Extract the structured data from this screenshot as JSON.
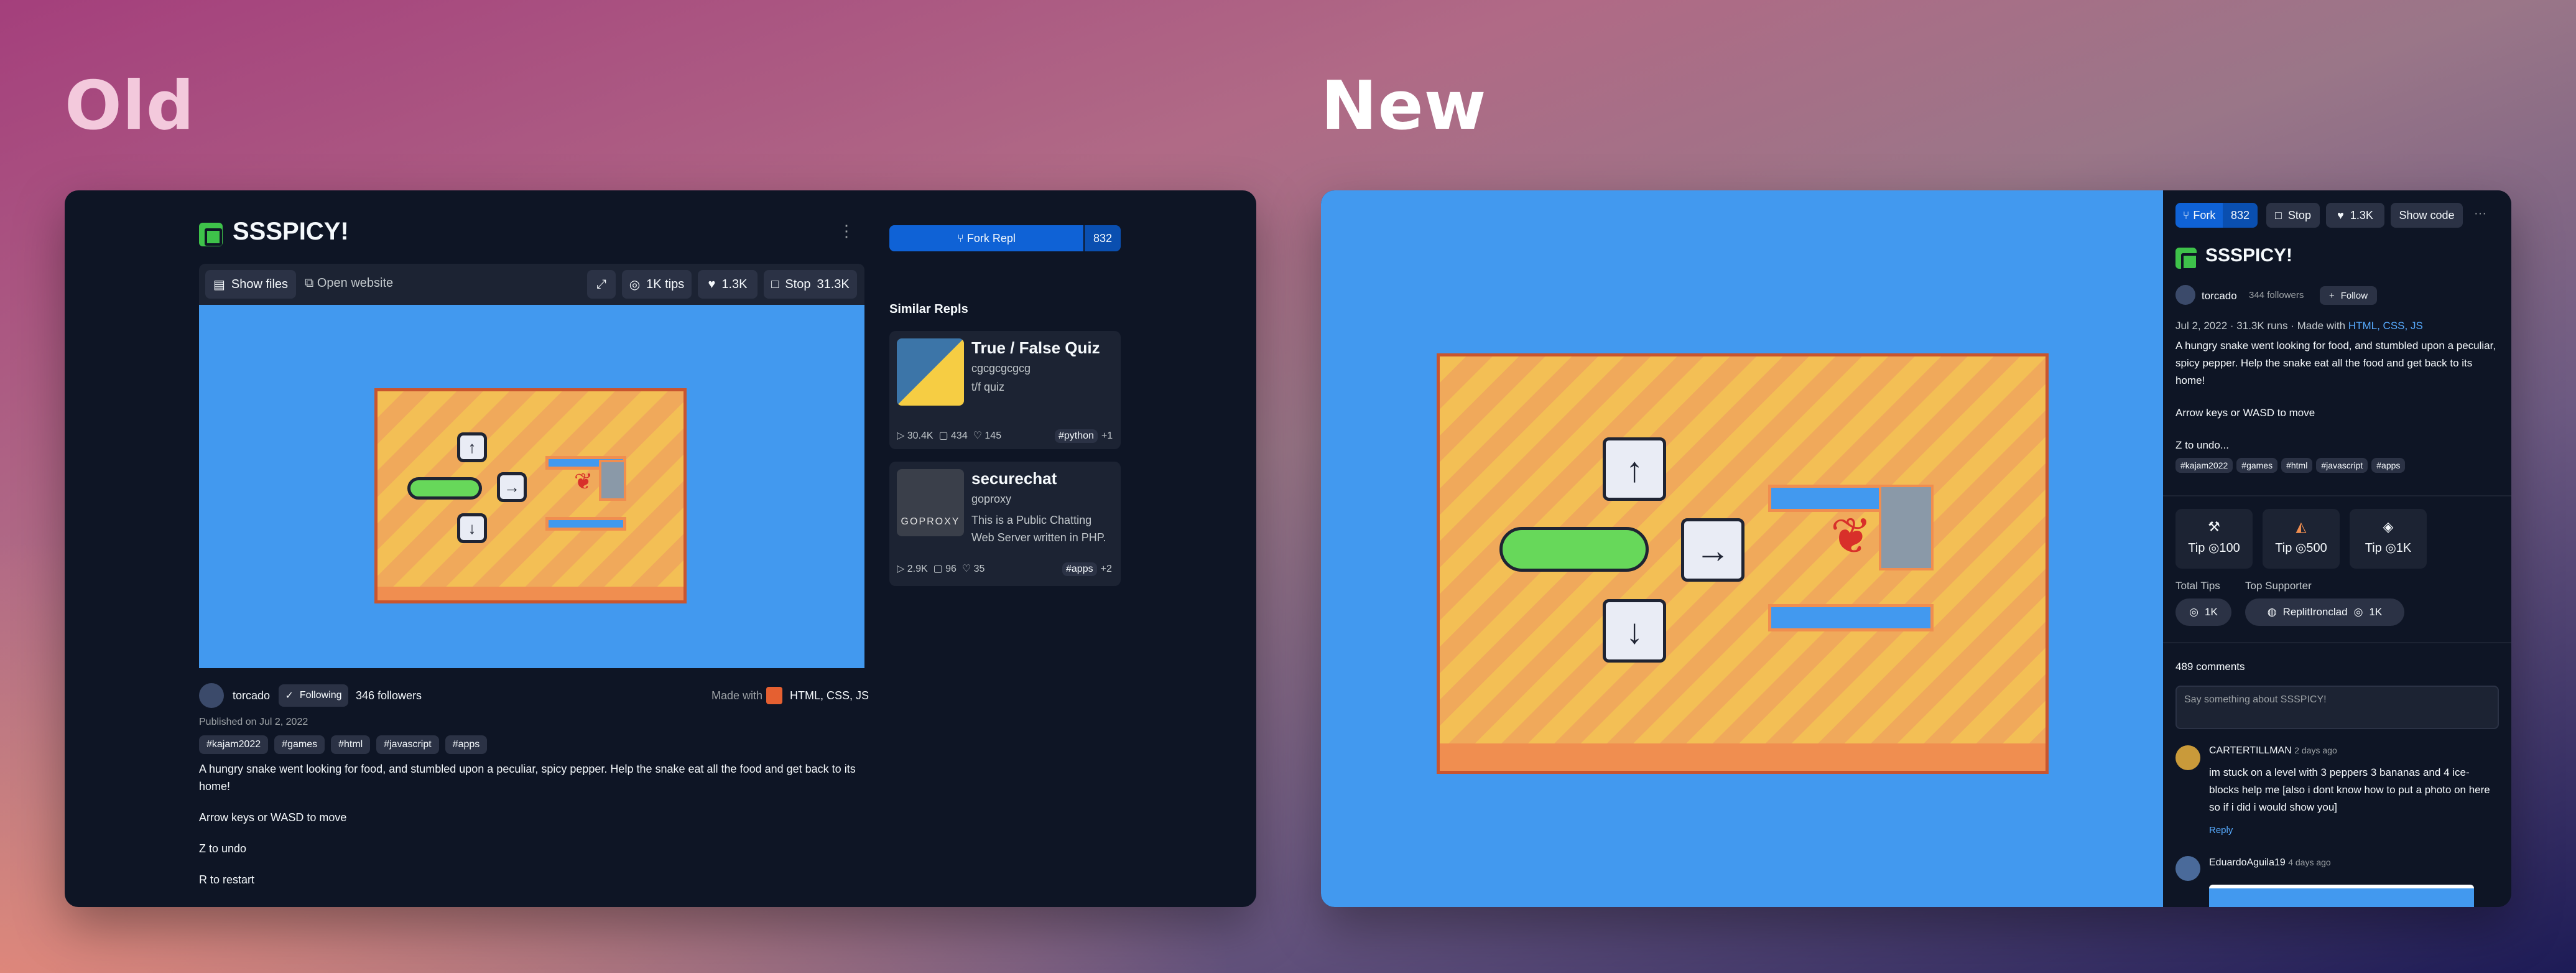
{
  "headings": {
    "old": "Old",
    "new": "New"
  },
  "old": {
    "title": "SSSPICY!",
    "toolbar": {
      "show_files": "Show files",
      "open_website": "Open website",
      "tips": "1K tips",
      "likes": "1.3K",
      "stop": "Stop",
      "runs": "31.3K"
    },
    "author": {
      "name": "torcado",
      "following": "Following",
      "followers": "346 followers",
      "made_with_label": "Made with",
      "made_with": "HTML, CSS, JS"
    },
    "published": "Published on Jul 2, 2022",
    "tags": [
      "#kajam2022",
      "#games",
      "#html",
      "#javascript",
      "#apps"
    ],
    "description": [
      "A hungry snake went looking for food, and stumbled upon a peculiar, spicy pepper. Help the snake eat all the food and get back to its home!",
      "Arrow keys or WASD to move",
      "Z to undo",
      "R to restart"
    ],
    "fork": {
      "label": "Fork Repl",
      "count": "832"
    },
    "similar_heading": "Similar Repls",
    "similar": [
      {
        "title": "True / False Quiz",
        "author": "cgcgcgcgcg",
        "desc": "t/f quiz",
        "runs": "30.4K",
        "comments": "434",
        "likes": "145",
        "tag": "#python",
        "extra": "+1"
      },
      {
        "title": "securechat",
        "author": "goproxy",
        "desc": "This is a Public Chatting Web Server written in PHP.",
        "runs": "2.9K",
        "comments": "96",
        "likes": "35",
        "tag": "#apps",
        "extra": "+2",
        "thumb_text": "GOPROXY"
      }
    ]
  },
  "new": {
    "toolbar": {
      "fork": "Fork",
      "fork_count": "832",
      "stop": "Stop",
      "likes": "1.3K",
      "show_code": "Show code",
      "more": "···"
    },
    "title": "SSSPICY!",
    "author": {
      "name": "torcado",
      "followers": "344 followers",
      "follow": "Follow"
    },
    "meta": {
      "date_runs": "Jul 2, 2022 · 31.3K runs · Made with",
      "made_with": "HTML, CSS, JS"
    },
    "description": [
      "A hungry snake went looking for food, and stumbled upon a peculiar, spicy pepper. Help the snake eat all the food and get back to its home!",
      "Arrow keys or WASD to move",
      "Z to undo..."
    ],
    "tags": [
      "#kajam2022",
      "#games",
      "#html",
      "#javascript",
      "#apps"
    ],
    "tips": [
      {
        "label": "Tip",
        "amount": "100"
      },
      {
        "label": "Tip",
        "amount": "500"
      },
      {
        "label": "Tip",
        "amount": "1K"
      }
    ],
    "total_tips_label": "Total Tips",
    "total_tips": "1K",
    "top_supporter_label": "Top Supporter",
    "top_supporter": "ReplitIronclad",
    "top_supporter_amount": "1K",
    "comments_count": "489 comments",
    "comment_placeholder": "Say something about SSSPICY!",
    "comments": [
      {
        "user": "CARTERTILLMAN",
        "time": "2 days ago",
        "text": "im stuck on a level with 3 peppers 3 bananas and 4 ice-blocks help me [also i dont know how to put a photo on here so if i did i would show you]",
        "reply": "Reply"
      },
      {
        "user": "EduardoAguila19",
        "time": "4 days ago"
      }
    ]
  },
  "colors": {
    "accent": "#0f62d6",
    "game_blue": "#4299ef",
    "panel": "#0e1525"
  }
}
